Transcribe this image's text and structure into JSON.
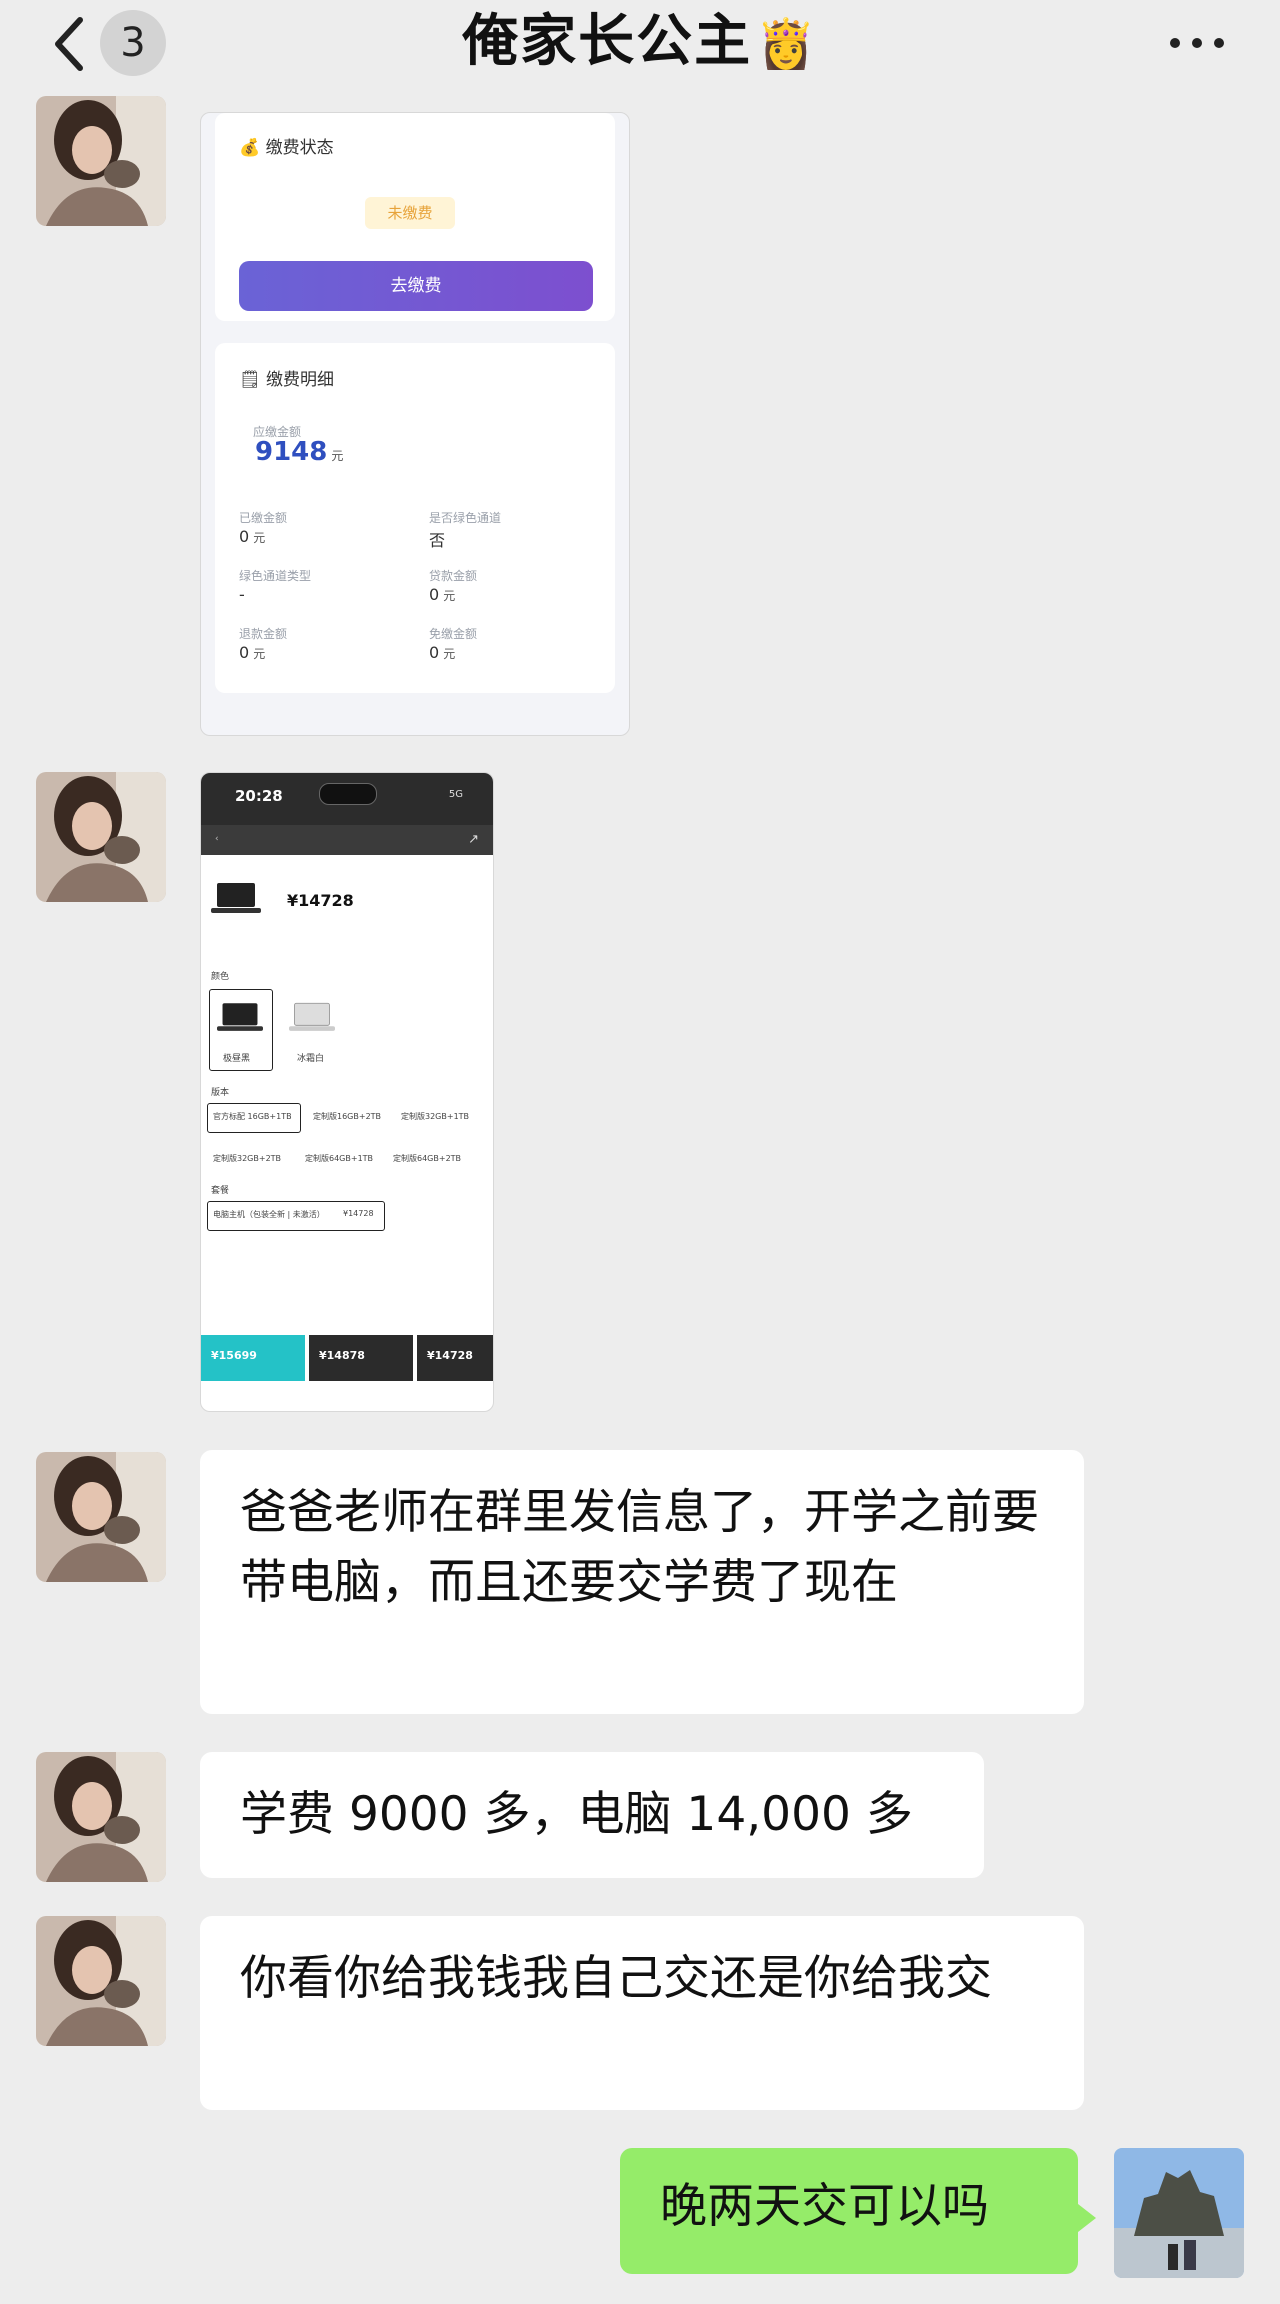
{
  "header": {
    "title": "俺家长公主",
    "title_emoji": "👸",
    "unread_count": "3"
  },
  "messages": [
    {
      "type": "image",
      "fee_card": {
        "status_section_title": "缴费状态",
        "status_badge": "未缴费",
        "pay_button": "去缴费",
        "detail_section_title": "缴费明细",
        "total_label": "应缴金额",
        "total_amount": "9148",
        "total_unit": "元",
        "fields": [
          {
            "label": "已缴金额",
            "value": "0",
            "unit": "元"
          },
          {
            "label": "是否绿色通道",
            "value": "否",
            "unit": ""
          },
          {
            "label": "绿色通道类型",
            "value": "-",
            "unit": ""
          },
          {
            "label": "贷款金额",
            "value": "0",
            "unit": "元"
          },
          {
            "label": "退款金额",
            "value": "0",
            "unit": "元"
          },
          {
            "label": "免缴金额",
            "value": "0",
            "unit": "元"
          }
        ]
      }
    },
    {
      "type": "image",
      "shop_screenshot": {
        "time": "20:28",
        "network": "5G",
        "price": "¥14728",
        "color_label": "颜色",
        "colors": [
          "极昼黑",
          "冰霜白"
        ],
        "version_label": "版本",
        "versions": [
          "官方标配 16GB+1TB",
          "定制版16GB+2TB",
          "定制版32GB+1TB",
          "定制版32GB+2TB",
          "定制版64GB+1TB",
          "定制版64GB+2TB"
        ],
        "bundle_label": "套餐",
        "bundle_selected": "电脑主机（包装全新 | 未激活）",
        "bundle_selected_price": "¥14728",
        "footer_prices": [
          "¥15699",
          "¥14878",
          "¥14728"
        ]
      }
    },
    {
      "type": "text",
      "text": "爸爸老师在群里发信息了，开学之前要带电脑，而且还要交学费了现在"
    },
    {
      "type": "text",
      "text": "学费 9000 多，电脑 14,000 多"
    },
    {
      "type": "text",
      "text": "你看你给我钱我自己交还是你给我交"
    },
    {
      "type": "text",
      "mine": true,
      "text": "晚两天交可以吗"
    }
  ]
}
